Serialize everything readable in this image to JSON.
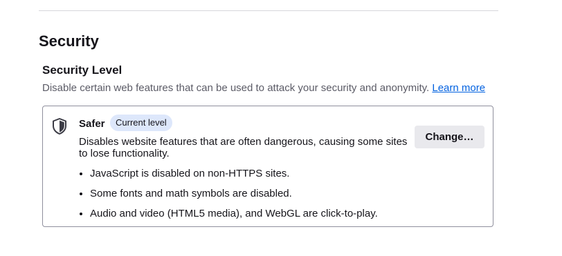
{
  "section": {
    "title": "Security"
  },
  "security_level": {
    "title": "Security Level",
    "description": "Disable certain web features that can be used to attack your security and anonymity.",
    "learn_more_label": "Learn more",
    "current": {
      "icon": "shield-icon",
      "name": "Safer",
      "badge": "Current level",
      "description": "Disables website features that are often dangerous, causing some sites to lose functionality.",
      "features": [
        "JavaScript is disabled on non-HTTPS sites.",
        "Some fonts and math symbols are disabled.",
        "Audio and video (HTML5 media), and WebGL are click-to-play."
      ],
      "change_label": "Change…"
    }
  },
  "colors": {
    "link": "#0061e0",
    "badge_background": "#dde7fb",
    "button_background": "#e9e9ed",
    "box_border": "#8f8f9d"
  }
}
